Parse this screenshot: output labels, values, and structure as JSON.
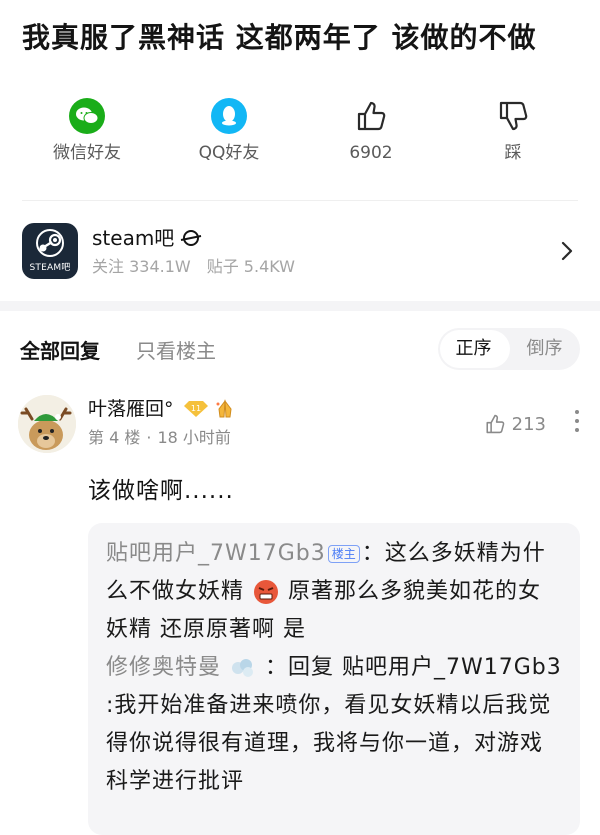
{
  "post": {
    "title": "我真服了黑神话 这都两年了 该做的不做"
  },
  "share": [
    {
      "label": "微信好友",
      "icon": "wechat-icon",
      "color": "#1aad19"
    },
    {
      "label": "QQ好友",
      "icon": "qq-icon",
      "color": "#12b7f5"
    },
    {
      "label": "6902",
      "icon": "thumbs-up-icon"
    },
    {
      "label": "踩",
      "icon": "thumbs-down-icon"
    }
  ],
  "forum": {
    "name": "steam吧",
    "avatar_tag": "STEAM吧",
    "followers": "关注 334.1W",
    "posts": "贴子 5.4KW"
  },
  "replies": {
    "tab_all": "全部回复",
    "tab_op": "只看楼主",
    "sort_asc": "正序",
    "sort_desc": "倒序"
  },
  "comment": {
    "user": "叶落雁回°",
    "level": "11",
    "floor": "第 4 楼",
    "time": "18 小时前",
    "likes": "213",
    "text": "该做啥啊......",
    "quote": {
      "user1": "贴吧用户_7W17Gb3",
      "op_tag": "楼主",
      "part1": "：这么多妖精为什么不做女妖精",
      "part2": "原著那么多貌美如花的女妖精 还原原著啊 是",
      "user2": "修修奥特曼",
      "part3": "：回复 贴吧用户_7W17Gb3 :我开始准备进来喷你，看见女妖精以后我觉得你说得很有道理，我将与你一道，对游戏科学进行批评"
    }
  }
}
